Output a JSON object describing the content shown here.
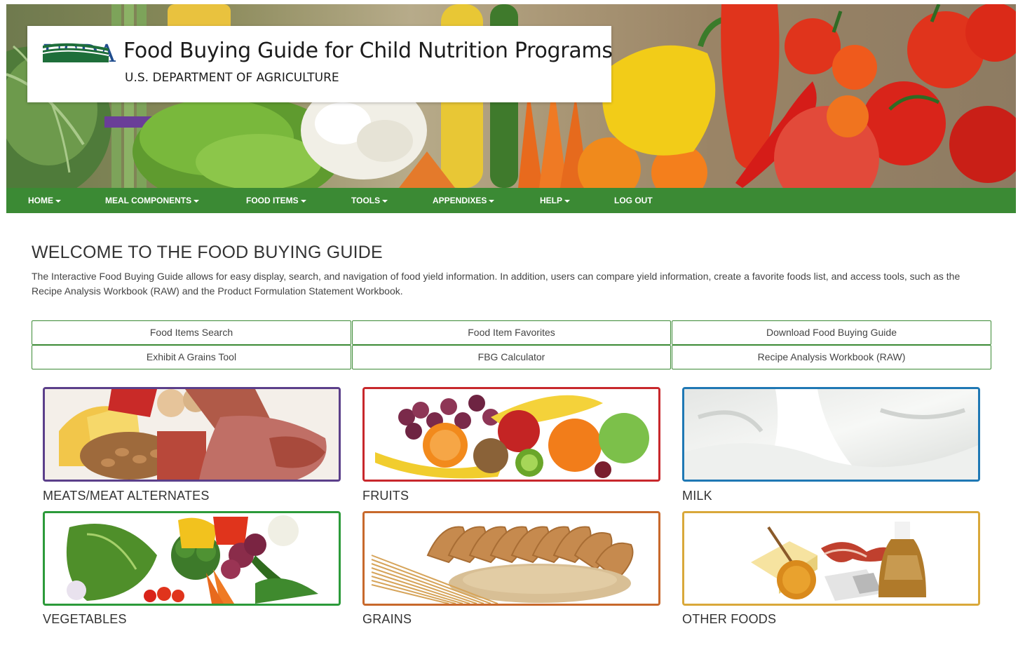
{
  "header": {
    "logo_text": "USDA",
    "title": "Food Buying Guide for Child Nutrition Programs",
    "subtitle": "U.S. DEPARTMENT OF AGRICULTURE"
  },
  "nav": {
    "items": [
      {
        "label": "HOME",
        "dropdown": true
      },
      {
        "label": "MEAL COMPONENTS",
        "dropdown": true
      },
      {
        "label": "FOOD ITEMS",
        "dropdown": true
      },
      {
        "label": "TOOLS",
        "dropdown": true
      },
      {
        "label": "APPENDIXES",
        "dropdown": true
      },
      {
        "label": "HELP",
        "dropdown": true
      },
      {
        "label": "LOG OUT",
        "dropdown": false
      }
    ]
  },
  "main": {
    "title": "WELCOME TO THE FOOD BUYING GUIDE",
    "intro": "The Interactive Food Buying Guide allows for easy display, search, and navigation of food yield information. In addition, users can compare yield information, create a favorite foods list, and access tools, such as the Recipe Analysis Workbook (RAW) and the Product Formulation Statement Workbook.",
    "tool_buttons": [
      "Food Items Search",
      "Food Item Favorites",
      "Download Food Buying Guide",
      "Exhibit A Grains Tool",
      "FBG Calculator",
      "Recipe Analysis Workbook (RAW)"
    ],
    "categories": [
      {
        "label": "MEATS/MEAT ALTERNATES",
        "border_color": "#5b3f8a"
      },
      {
        "label": "FRUITS",
        "border_color": "#c8282c"
      },
      {
        "label": "MILK",
        "border_color": "#1f78b4"
      },
      {
        "label": "VEGETABLES",
        "border_color": "#2c9a3a"
      },
      {
        "label": "GRAINS",
        "border_color": "#c8692c"
      },
      {
        "label": "OTHER FOODS",
        "border_color": "#d9a83a"
      }
    ]
  },
  "colors": {
    "nav_green": "#3b8a34",
    "usda_blue": "#1f4c8e",
    "usda_green": "#1e6e3a"
  }
}
